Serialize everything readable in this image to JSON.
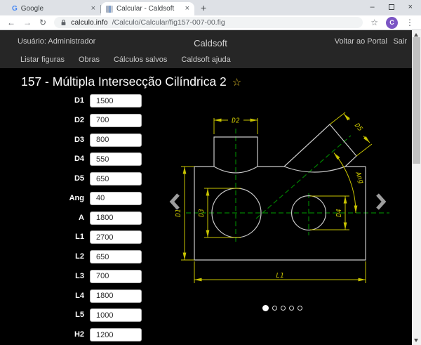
{
  "browser": {
    "tab_inactive": {
      "title": "Google",
      "favicon_letter": "G"
    },
    "tab_active": {
      "title": "Calcular - Caldsoft"
    },
    "close_glyph": "×",
    "new_tab_glyph": "+",
    "controls": {
      "minimize": "–",
      "close": "×"
    },
    "nav": {
      "back": "←",
      "forward": "→",
      "reload": "↻"
    },
    "url": {
      "host": "calculo.info",
      "path": "/Calculo/Calcular/fig157-007-00.fig"
    },
    "bookmark_glyph": "☆",
    "avatar_letter": "C",
    "menu_glyph": "⋮"
  },
  "site_header": {
    "user": "Usuário: Administrador",
    "brand": "Caldsoft",
    "portal_link": "Voltar ao Portal",
    "logout_link": "Sair",
    "nav_items": [
      "Listar figuras",
      "Obras",
      "Cálculos salvos",
      "Caldsoft ajuda"
    ]
  },
  "page": {
    "title": "157 - Múltipla Intersecção Cilíndrica 2",
    "favorite_glyph": "☆"
  },
  "form": {
    "fields": [
      {
        "label": "D1",
        "value": "1500"
      },
      {
        "label": "D2",
        "value": "700"
      },
      {
        "label": "D3",
        "value": "800"
      },
      {
        "label": "D4",
        "value": "550"
      },
      {
        "label": "D5",
        "value": "650"
      },
      {
        "label": "Ang",
        "value": "40"
      },
      {
        "label": "A",
        "value": "1800"
      },
      {
        "label": "L1",
        "value": "2700"
      },
      {
        "label": "L2",
        "value": "650"
      },
      {
        "label": "L3",
        "value": "700"
      },
      {
        "label": "L4",
        "value": "1800"
      },
      {
        "label": "L5",
        "value": "1000"
      },
      {
        "label": "H2",
        "value": "1200"
      }
    ]
  },
  "figure": {
    "dim_labels": {
      "d1": "D1",
      "d2": "D2",
      "d3": "D3",
      "d4": "D4",
      "d5": "D5",
      "ang": "Ang",
      "l1": "L1"
    },
    "colors": {
      "dimension": "#c9c400",
      "centerline": "#008000",
      "outline": "#c8c8c8",
      "background": "#000000"
    },
    "pagination": {
      "total": 5,
      "active_index": 0
    }
  }
}
